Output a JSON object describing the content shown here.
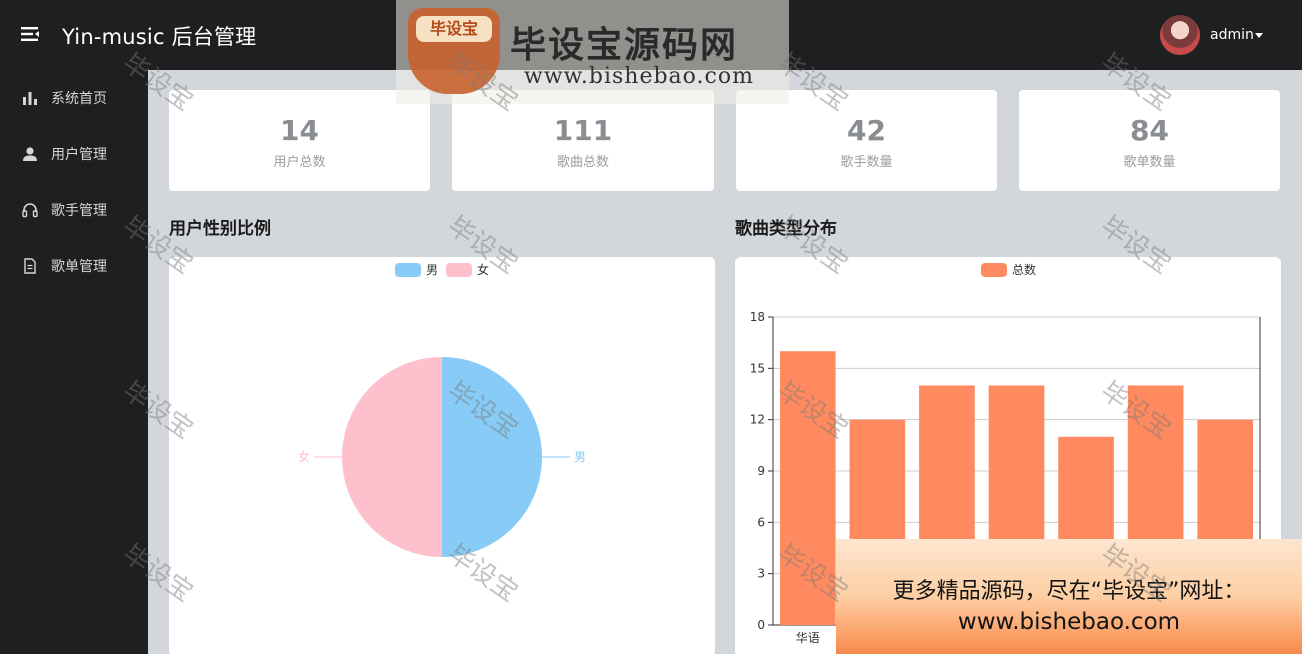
{
  "header": {
    "title": "Yin-music 后台管理",
    "username": "admin",
    "menu_icon": "menu-fold-icon",
    "avatar_icon": "user-avatar"
  },
  "sidebar": {
    "items": [
      {
        "label": "系统首页",
        "icon": "bar-chart-icon"
      },
      {
        "label": "用户管理",
        "icon": "user-icon"
      },
      {
        "label": "歌手管理",
        "icon": "headphones-icon"
      },
      {
        "label": "歌单管理",
        "icon": "document-icon"
      }
    ]
  },
  "stats": [
    {
      "value": "14",
      "label": "用户总数"
    },
    {
      "value": "111",
      "label": "歌曲总数"
    },
    {
      "value": "42",
      "label": "歌手数量"
    },
    {
      "value": "84",
      "label": "歌单数量"
    }
  ],
  "gender_section": {
    "title": "用户性别比例"
  },
  "genre_section": {
    "title": "歌曲类型分布"
  },
  "colors": {
    "sidebar_bg": "#1e1f21",
    "page_bg": "#d3d7db",
    "male": "#87cbf6",
    "female": "#ffc0cd",
    "bar": "#ff8a5f"
  },
  "chart_data": [
    {
      "type": "pie",
      "labels": [
        "男",
        "女"
      ],
      "values": [
        50,
        50
      ],
      "legend": [
        "男",
        "女"
      ],
      "legend_position": "top-center"
    },
    {
      "type": "bar",
      "categories": [
        "华语",
        "",
        "",
        "",
        "",
        "",
        ""
      ],
      "series": [
        {
          "name": "总数",
          "values": [
            16,
            12,
            14,
            14,
            11,
            14,
            12
          ]
        }
      ],
      "ylim": [
        0,
        18
      ],
      "yticks": [
        0,
        3,
        6,
        9,
        12,
        15,
        18
      ],
      "grid": true,
      "legend_position": "top-center"
    }
  ],
  "watermark": {
    "brand": "毕设宝源码网",
    "logo_text": "毕设宝",
    "url": "www.bishebao.com",
    "tile_text": "毕设宝"
  },
  "promo": {
    "line1": "更多精品源码，尽在“毕设宝”网址：",
    "line2": "www.bishebao.com"
  }
}
